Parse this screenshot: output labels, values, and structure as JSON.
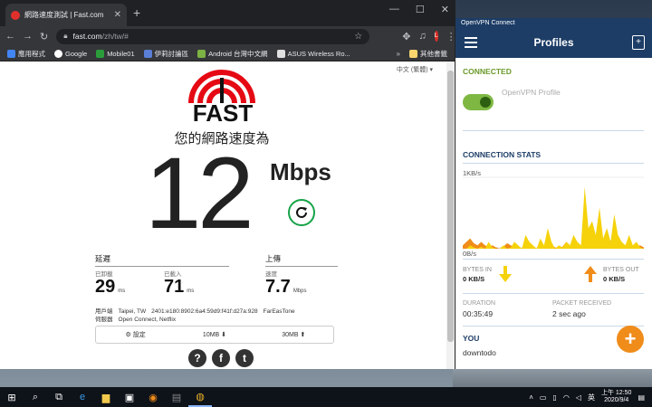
{
  "browser": {
    "tab_title": "網路速度測試 | Fast.com",
    "url_host": "fast.com",
    "url_path": "/zh/tw/#",
    "bookmarks": [
      {
        "label": "應用程式",
        "color": "#4285f4"
      },
      {
        "label": "Google",
        "color": "#34a853"
      },
      {
        "label": "Mobile01",
        "color": "#2a9d3a"
      },
      {
        "label": "伊莉討論區",
        "color": "#5b7fd6"
      },
      {
        "label": "Android 台灣中文網",
        "color": "#7cb342"
      },
      {
        "label": "ASUS Wireless Ro...",
        "color": "#e0e0e0"
      }
    ],
    "bookmarks_more": "其他書籤",
    "profile_initial": "L"
  },
  "fast": {
    "language": "中文 (繁體)",
    "logo_text": "FAST",
    "headline": "您的網路速度為",
    "speed": "12",
    "unit": "Mbps",
    "latency_header": "延遲",
    "upload_header": "上傳",
    "unloaded_label": "已卸載",
    "unloaded_value": "29",
    "loaded_label": "已載入",
    "loaded_value": "71",
    "ms_unit": "ms",
    "speed_label": "速度",
    "upload_value": "7.7",
    "upload_unit": "Mbps",
    "client_label": "用戶端",
    "client_location": "Taipei, TW",
    "client_ip": "2401:e180:8902:6a4:59d9:f41f:d27a:928",
    "client_isp": "FarEasTone",
    "server_label": "伺服器",
    "server_value": "Open Connect, Netflix",
    "settings_label": "設定",
    "download_size": "10MB",
    "upload_size": "30MB"
  },
  "vpn": {
    "window_title": "OpenVPN Connect",
    "header_title": "Profiles",
    "status": "CONNECTED",
    "profile_name": "OpenVPN Profile",
    "toggle_on": true,
    "stats_header": "CONNECTION STATS",
    "axis_top": "1KB/s",
    "axis_bottom": "0B/s",
    "bytes_in_label": "BYTES IN",
    "bytes_in_value": "0 KB/S",
    "bytes_out_label": "BYTES OUT",
    "bytes_out_value": "0 KB/S",
    "duration_label": "DURATION",
    "duration_value": "00:35:49",
    "packet_label": "PACKET RECEIVED",
    "packet_value": "2 sec ago",
    "you_label": "YOU",
    "you_value": "downtodo",
    "colors": {
      "header": "#1d3d66",
      "accent_green": "#7eb843",
      "in_yellow": "#f5d20a",
      "out_orange": "#f08c1a"
    },
    "traffic_in": [
      0,
      0,
      0.05,
      0.02,
      0,
      0.03,
      0,
      0.1,
      0.02,
      0,
      0,
      0.05,
      0,
      0.02,
      0.1,
      0.05,
      0,
      0.2,
      0.1,
      0.05,
      0,
      0.15,
      0.05,
      0.3,
      0.1,
      0,
      0.05,
      0.02,
      0.1,
      0.05,
      0.2,
      0.1,
      0.05,
      0.9,
      0.3,
      0.4,
      0.2,
      0.6,
      0.15,
      0.3,
      0.1,
      0.5,
      0.2,
      0.1,
      0.05,
      0.2,
      0.05,
      0.1,
      0.02,
      0
    ],
    "traffic_out": [
      0.05,
      0.1,
      0.15,
      0.08,
      0.05,
      0.1,
      0.05,
      0.03,
      0.05,
      0.02,
      0,
      0.03,
      0.08,
      0.05,
      0.02,
      0.03,
      0,
      0.05,
      0.03,
      0.02,
      0,
      0.04,
      0.02,
      0.03,
      0.05,
      0.02,
      0,
      0.03,
      0.1,
      0.05,
      0.1,
      0.03,
      0.05,
      0.1,
      0.08,
      0.05,
      0.1,
      0.05,
      0.08,
      0.03,
      0.12,
      0.05,
      0.1,
      0.03,
      0.05,
      0.1,
      0.04,
      0.03,
      0.05,
      0.02
    ]
  },
  "taskbar": {
    "ime": "英",
    "time": "上午 12:50",
    "date": "2020/9/4"
  }
}
